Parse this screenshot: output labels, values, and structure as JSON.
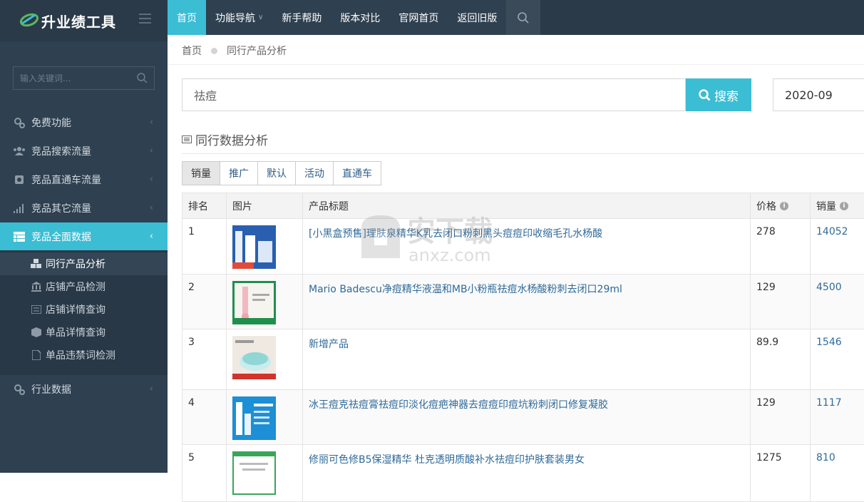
{
  "app": {
    "logo_text": "升业绩工具"
  },
  "sidebar": {
    "search_placeholder": "输入关键词...",
    "items": [
      {
        "label": "免费功能",
        "icon": "gears-icon"
      },
      {
        "label": "竞品搜索流量",
        "icon": "users-icon"
      },
      {
        "label": "竞品直通车流量",
        "icon": "cart-box-icon"
      },
      {
        "label": "竞品其它流量",
        "icon": "signal-icon"
      },
      {
        "label": "竞品全面数据",
        "icon": "table-icon",
        "active": true
      },
      {
        "label": "行业数据",
        "icon": "gears-icon"
      }
    ],
    "subitems": [
      {
        "label": "同行产品分析",
        "icon": "cubes-icon",
        "active": true
      },
      {
        "label": "店铺产品检测",
        "icon": "bank-icon"
      },
      {
        "label": "店铺详情查询",
        "icon": "list-icon"
      },
      {
        "label": "单品详情查询",
        "icon": "cube-icon"
      },
      {
        "label": "单品违禁词检测",
        "icon": "file-icon"
      }
    ]
  },
  "topnav": {
    "items": [
      "首页",
      "功能导航",
      "新手帮助",
      "版本对比",
      "官网首页",
      "返回旧版"
    ]
  },
  "breadcrumb": {
    "home": "首页",
    "current": "同行产品分析"
  },
  "search": {
    "value": "祛痘",
    "button_label": "搜索",
    "date": "2020-09"
  },
  "section": {
    "title": "同行数据分析"
  },
  "tabs": [
    "销量",
    "推广",
    "默认",
    "活动",
    "直通车"
  ],
  "table": {
    "headers": {
      "rank": "排名",
      "image": "图片",
      "title": "产品标题",
      "price": "价格",
      "sales": "销量"
    },
    "rows": [
      {
        "rank": "1",
        "title": "[小黑盒预售]理肤泉精华K乳去闭口粉刺黑头痘痘印收缩毛孔水杨酸",
        "price": "278",
        "sales": "14052"
      },
      {
        "rank": "2",
        "title": "Mario Badescu净痘精华液温和MB小粉瓶祛痘水杨酸粉刺去闭口29ml",
        "price": "129",
        "sales": "4500"
      },
      {
        "rank": "3",
        "title": "新增产品",
        "price": "89.9",
        "sales": "1546"
      },
      {
        "rank": "4",
        "title": "冰王痘克祛痘膏祛痘印淡化痘疤神器去痘痘印痘坑粉刺闭口修复凝胶",
        "price": "129",
        "sales": "1117"
      },
      {
        "rank": "5",
        "title": "修丽可色修B5保湿精华 杜克透明质酸补水祛痘印护肤套装男女",
        "price": "1275",
        "sales": "810"
      }
    ]
  },
  "watermark": {
    "text": "安下载",
    "subtext": "anxz.com"
  },
  "colors": {
    "accent": "#3bbdd4",
    "sidebar": "#2f4050",
    "link": "#2f6a9a"
  }
}
